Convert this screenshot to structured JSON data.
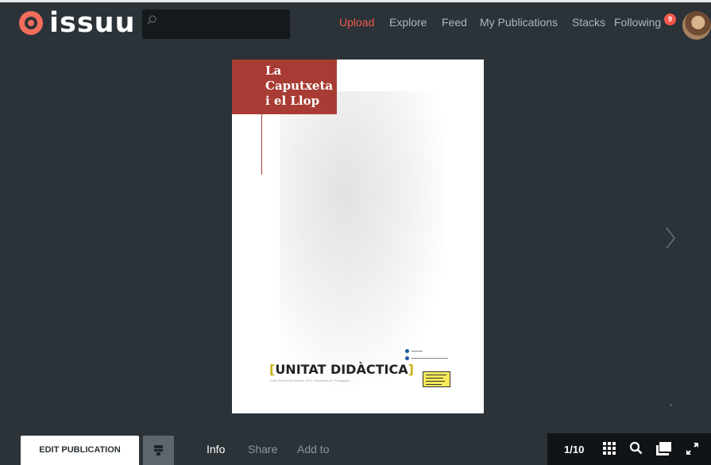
{
  "app": {
    "logo_text": "issuu",
    "accent_color": "#f3584a"
  },
  "search": {
    "placeholder": "",
    "icon": "search-icon"
  },
  "nav": {
    "upload": "Upload",
    "explore": "Explore",
    "feed": "Feed",
    "my_publications": "My Publications",
    "stacks": "Stacks",
    "following": "Following",
    "notification_count": "9"
  },
  "document": {
    "title": "La\nCaputxeta\ni el Llop",
    "unit_open_bracket": "[",
    "unit_label": "UNITAT DIDÀCTICA",
    "unit_close_bracket": "]",
    "subtitle": "Ester Rivera Hernández 2016. Pràctiques de Pedagogia."
  },
  "toolbar": {
    "edit_label": "EDIT PUBLICATION",
    "tabs": [
      "Info",
      "Share",
      "Add to"
    ],
    "page_indicator": "1/10"
  },
  "icons": {
    "next": "chevron-right-icon",
    "grid": "grid-icon",
    "zoom": "zoom-icon",
    "display": "display-mode-icon",
    "fullscreen": "fullscreen-icon"
  }
}
